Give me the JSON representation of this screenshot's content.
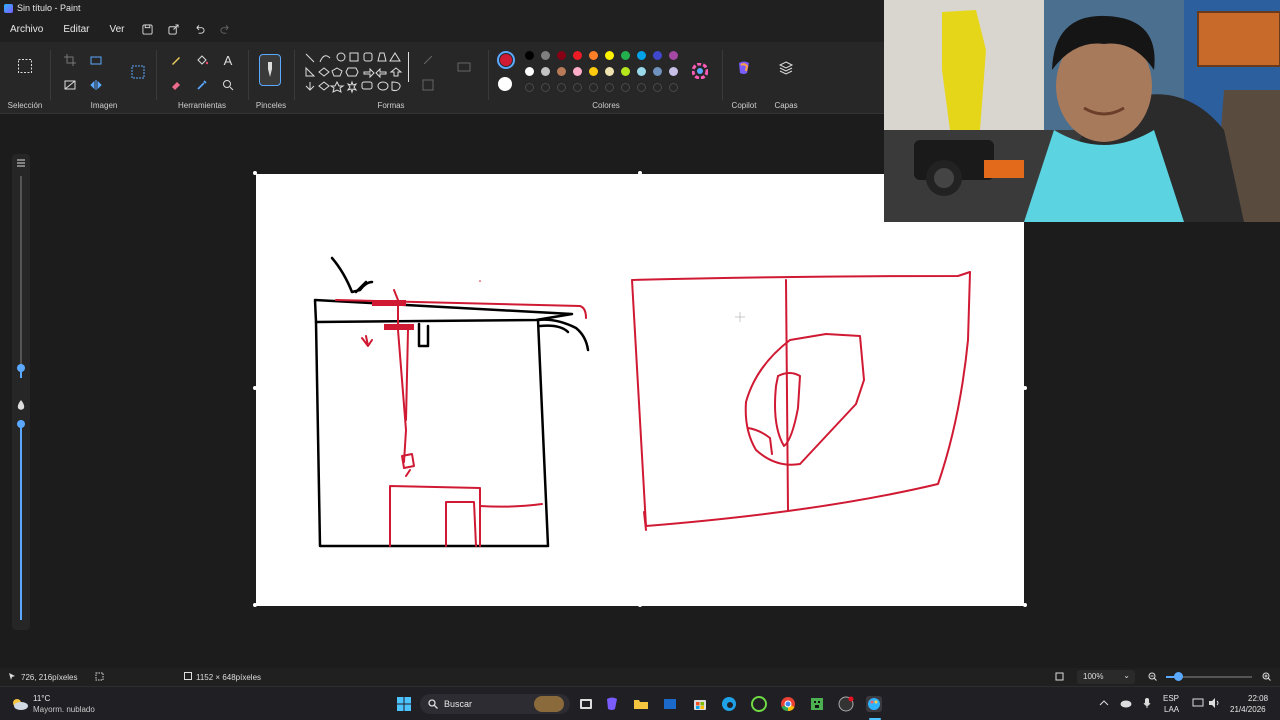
{
  "window": {
    "title": "Sin título - Paint"
  },
  "menu": {
    "archivo": "Archivo",
    "editar": "Editar",
    "ver": "Ver"
  },
  "ribbon": {
    "groups": {
      "seleccion": "Selección",
      "imagen": "Imagen",
      "herramientas": "Herramientas",
      "pinceles": "Pinceles",
      "formas": "Formas",
      "colores": "Colores",
      "copilot": "Copilot",
      "capas": "Capas"
    },
    "text_tool": "A",
    "accent": "#d01a33",
    "palette_row1": [
      "#000000",
      "#7f7f7f",
      "#880015",
      "#ed1c24",
      "#ff7f27",
      "#fff200",
      "#22b14c",
      "#00a2e8",
      "#3f48cc",
      "#a349a4"
    ],
    "palette_row2": [
      "#ffffff",
      "#c3c3c3",
      "#b97a57",
      "#ffaec9",
      "#ffc90e",
      "#efe4b0",
      "#b5e61d",
      "#99d9ea",
      "#7092be",
      "#c8bfe7"
    ]
  },
  "status": {
    "cursor_pos": "726, 216píxeles",
    "canvas_size": "1152 × 648píxeles",
    "zoom": "100%"
  },
  "taskbar": {
    "weather_temp": "11°C",
    "weather_desc": "Mayorm. nublado",
    "search": "Buscar",
    "lang": "ESP",
    "lang2": "LAA",
    "time": "22:08",
    "date": "21/4/2026"
  }
}
